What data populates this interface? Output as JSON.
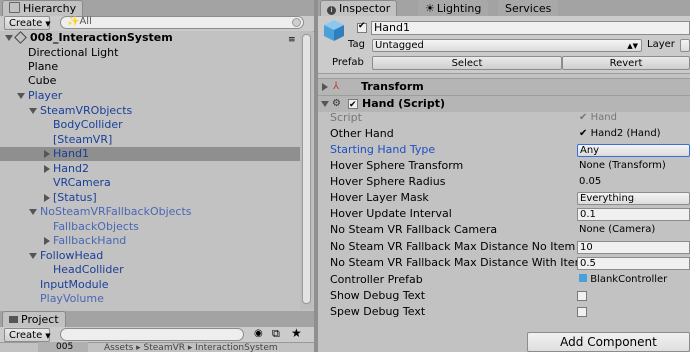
{
  "hierarchy": {
    "tab_label": "Hierarchy",
    "create_label": "Create",
    "search_placeholder": "✨All",
    "scene_name": "008_InteractionSystem",
    "rows": [
      {
        "label": "Directional Light"
      },
      {
        "label": "Plane"
      },
      {
        "label": "Cube"
      },
      {
        "label": "Player"
      },
      {
        "label": "SteamVRObjects"
      },
      {
        "label": "BodyCollider"
      },
      {
        "label": "[SteamVR]"
      },
      {
        "label": "Hand1"
      },
      {
        "label": "Hand2"
      },
      {
        "label": "VRCamera"
      },
      {
        "label": "[Status]"
      },
      {
        "label": "NoSteamVRFallbackObjects"
      },
      {
        "label": "FallbackObjects"
      },
      {
        "label": "FallbackHand"
      },
      {
        "label": "FollowHead"
      },
      {
        "label": "HeadCollider"
      },
      {
        "label": "InputModule"
      },
      {
        "label": "PlayVolume"
      }
    ]
  },
  "project": {
    "tab_label": "Project",
    "create_label": "Create",
    "folder_stub": "005",
    "path_text": "Assets ▸ SteamVR ▸ InteractionSystem"
  },
  "inspector": {
    "tabs": {
      "inspector": "Inspector",
      "lighting": "Lighting",
      "services": "Services"
    },
    "object_name": "Hand1",
    "tag_label": "Tag",
    "tag_value": "Untagged",
    "layer_label": "Layer",
    "prefab_label": "Prefab",
    "select_label": "Select",
    "revert_label": "Revert",
    "transform_title": "Transform",
    "script_title": "Hand (Script)",
    "props": [
      {
        "label": "Script",
        "value": "Hand"
      },
      {
        "label": "Other Hand",
        "value": "Hand2 (Hand)"
      },
      {
        "label": "Starting Hand Type",
        "value": "Any"
      },
      {
        "label": "Hover Sphere Transform",
        "value": "None (Transform)"
      },
      {
        "label": "Hover Sphere Radius",
        "value": "0.05"
      },
      {
        "label": "Hover Layer Mask",
        "value": "Everything"
      },
      {
        "label": "Hover Update Interval",
        "value": "0.1"
      },
      {
        "label": "No Steam VR Fallback Camera",
        "value": "None (Camera)"
      },
      {
        "label": "No Steam VR Fallback Max Distance No Item",
        "value": "10"
      },
      {
        "label": "No Steam VR Fallback Max Distance With Item",
        "value": "0.5"
      },
      {
        "label": "Controller Prefab",
        "value": "BlankController"
      },
      {
        "label": "Show Debug Text",
        "value": ""
      },
      {
        "label": "Spew Debug Text",
        "value": ""
      }
    ],
    "add_component_label": "Add Component"
  }
}
